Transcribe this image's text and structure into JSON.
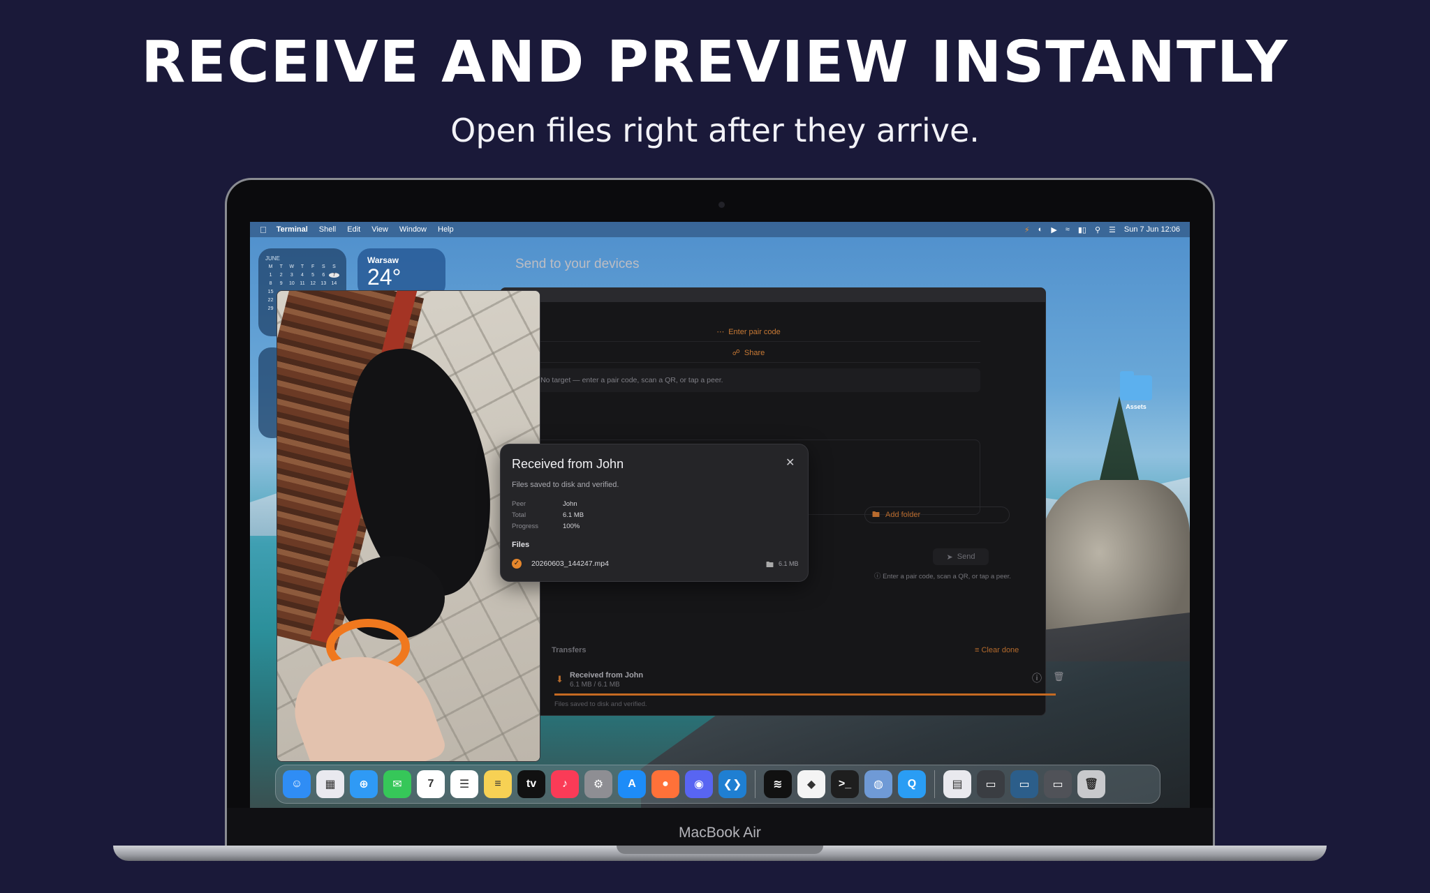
{
  "hero": {
    "headline": "RECEIVE AND PREVIEW INSTANTLY",
    "subline": "Open files right after they arrive."
  },
  "device": {
    "label": "MacBook Air"
  },
  "menubar": {
    "apple_icon": "apple-logo-icon",
    "items": [
      "Terminal",
      "Shell",
      "Edit",
      "View",
      "Window",
      "Help"
    ],
    "clock": "Sun 7 Jun  12:06"
  },
  "widgets": {
    "calendar": {
      "month": "JUNE",
      "weekdays": [
        "M",
        "T",
        "W",
        "T",
        "F",
        "S",
        "S"
      ],
      "days": [
        "1",
        "2",
        "3",
        "4",
        "5",
        "6",
        "7",
        "8",
        "9",
        "10",
        "11",
        "12",
        "13",
        "14",
        "15",
        "",
        "",
        "",
        "",
        "",
        "",
        "22",
        "",
        "",
        "",
        "",
        "",
        "",
        "29",
        "",
        "",
        "",
        "",
        "",
        ""
      ]
    },
    "weather": {
      "city": "Warsaw",
      "temp": "24°"
    }
  },
  "desktop": {
    "folder_label": "Assets"
  },
  "app": {
    "send_title": "Send to your devices",
    "enter_pair_code": "Enter pair code",
    "share": "Share",
    "no_target": "No target — enter a pair code, scan a QR, or tap a peer.",
    "add_folder": "Add folder",
    "send_button": "Send",
    "send_hint": "Enter a pair code, scan a QR, or tap a peer.",
    "transfers": {
      "heading": "Transfers",
      "clear_done": "Clear done",
      "item": {
        "title": "Received from John",
        "size": "6.1 MB / 6.1 MB",
        "status": "Files saved to disk and verified.",
        "progress": 1.0
      }
    }
  },
  "popup": {
    "title": "Received from John",
    "subtitle": "Files saved to disk and verified.",
    "details": [
      {
        "key": "Peer",
        "value": "John"
      },
      {
        "key": "Total",
        "value": "6.1 MB"
      },
      {
        "key": "Progress",
        "value": "100%"
      }
    ],
    "files_heading": "Files",
    "file": {
      "name": "20260603_144247.mp4",
      "size": "6.1 MB"
    }
  },
  "dock": {
    "apps": [
      {
        "name": "finder-icon",
        "color": "#2f8df5",
        "glyph": "☺"
      },
      {
        "name": "launchpad-icon",
        "color": "#e9e9ef",
        "glyph": "▦"
      },
      {
        "name": "safari-icon",
        "color": "#2f9af5",
        "glyph": "⊕"
      },
      {
        "name": "messages-icon",
        "color": "#36c759",
        "glyph": "✉"
      },
      {
        "name": "calendar-icon",
        "color": "#ffffff",
        "glyph": "7"
      },
      {
        "name": "reminders-icon",
        "color": "#ffffff",
        "glyph": "☰"
      },
      {
        "name": "notes-icon",
        "color": "#f7d154",
        "glyph": "≡"
      },
      {
        "name": "tv-icon",
        "color": "#111111",
        "glyph": "tv"
      },
      {
        "name": "music-icon",
        "color": "#fa3b57",
        "glyph": "♪"
      },
      {
        "name": "system-settings-icon",
        "color": "#8e8e93",
        "glyph": "⚙"
      },
      {
        "name": "app-store-icon",
        "color": "#1d8cf8",
        "glyph": "A"
      },
      {
        "name": "firefox-icon",
        "color": "#ff7139",
        "glyph": "●"
      },
      {
        "name": "discord-icon",
        "color": "#5865f2",
        "glyph": "◉"
      },
      {
        "name": "vscode-icon",
        "color": "#1f7fd2",
        "glyph": "❮❯"
      },
      {
        "name": "spotify-icon",
        "color": "#111111",
        "glyph": "≋"
      },
      {
        "name": "git-app-icon",
        "color": "#f4f4f4",
        "glyph": "◆"
      },
      {
        "name": "terminal-icon",
        "color": "#1e1e1e",
        "glyph": ">_"
      },
      {
        "name": "disk-utility-icon",
        "color": "#6f9ad6",
        "glyph": "◍"
      },
      {
        "name": "quicktime-icon",
        "color": "#2a9df4",
        "glyph": "Q"
      },
      {
        "name": "document-icon",
        "color": "#e9e9ee",
        "glyph": "▤"
      },
      {
        "name": "window-thumbnail-icon",
        "color": "#3a3d42",
        "glyph": "▭"
      },
      {
        "name": "window-thumbnail-icon-2",
        "color": "#2c5e8a",
        "glyph": "▭"
      },
      {
        "name": "screenshot-thumbnail-icon",
        "color": "#505258",
        "glyph": "▭"
      },
      {
        "name": "trash-icon",
        "color": "#c8c9cc",
        "glyph": "🗑"
      }
    ]
  }
}
